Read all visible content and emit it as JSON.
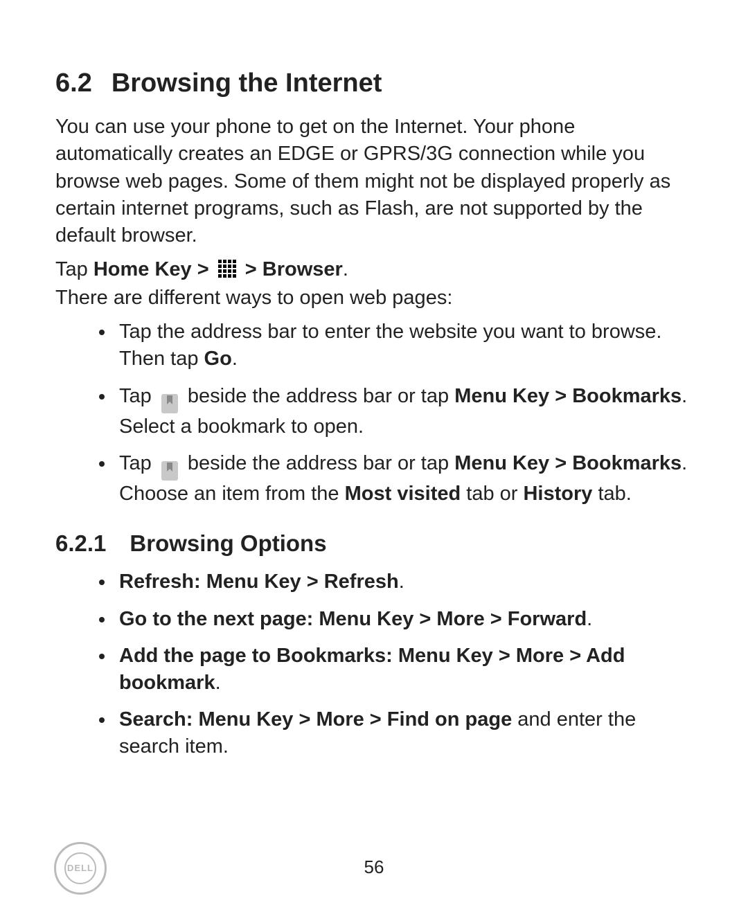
{
  "heading": {
    "num": "6.2",
    "title": "Browsing the Internet"
  },
  "intro": "You can use your phone to get on the Internet. Your phone automatically creates an EDGE or GPRS/3G connection while you browse web pages. Some of them might not be displayed properly as certain internet programs, such as Flash, are not supported by the default browser.",
  "tapline": {
    "t1": "Tap ",
    "b1": "Home Key > ",
    "b2": " > Browser",
    "t2": "."
  },
  "waysline": "There are different ways to open web pages:",
  "ways": {
    "w1a": "Tap the address bar to enter the website you want to browse. Then tap ",
    "w1b": "Go",
    "w1c": ".",
    "w2a": "Tap ",
    "w2b": " beside the address bar or tap ",
    "w2c": "Menu Key > Bookmarks",
    "w2d": ". Select a bookmark to open.",
    "w3a": "Tap ",
    "w3b": " beside the address bar or tap ",
    "w3c": "Menu Key > Bookmarks",
    "w3d": ". Choose an item from the ",
    "w3e": "Most visited",
    "w3f": " tab or ",
    "w3g": "History",
    "w3h": " tab."
  },
  "subheading": {
    "num": "6.2.1",
    "title": "Browsing Options"
  },
  "options": {
    "o1": "Refresh: Menu Key > Refresh",
    "dot": ".",
    "o2": "Go to the next page: Menu Key > More > Forward",
    "o3": "Add the page to Bookmarks: Menu Key > More > Add bookmark",
    "o4a": "Search: Menu Key > More > Find on page",
    "o4b": " and enter the search item."
  },
  "pageNumber": "56",
  "logoText": "DELL"
}
